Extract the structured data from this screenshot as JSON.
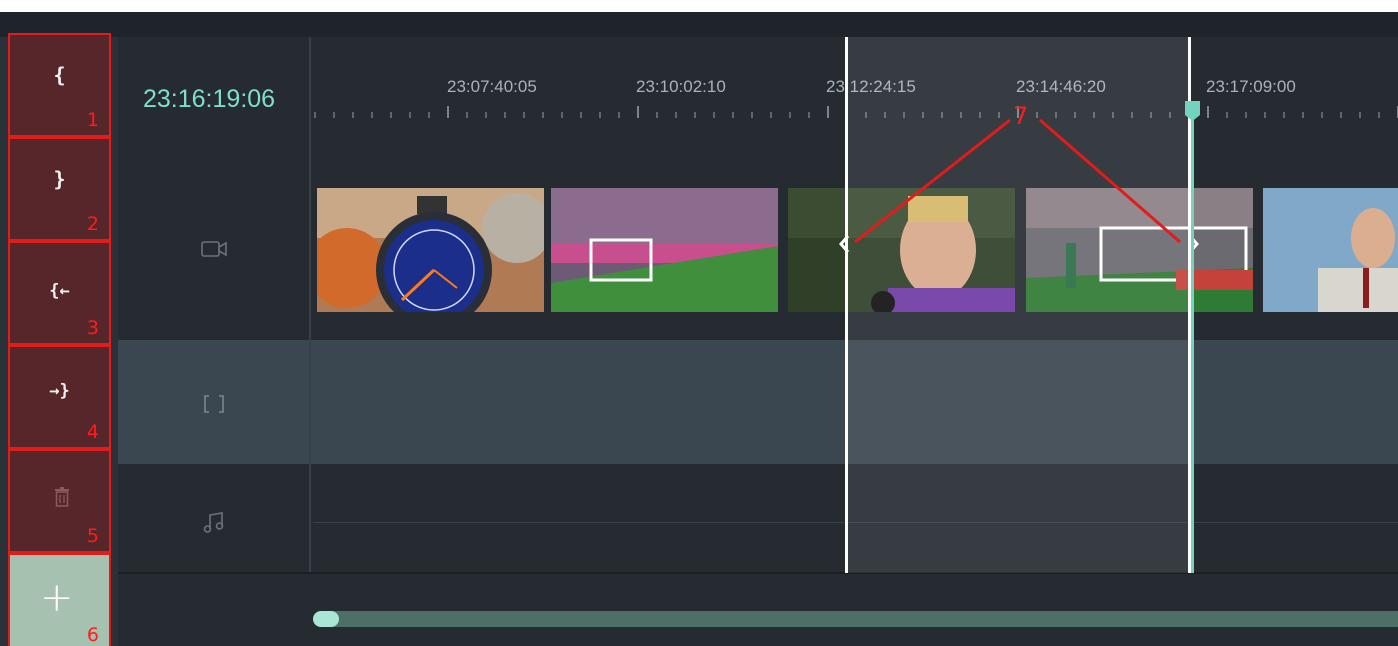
{
  "timeline": {
    "current_time": "23:16:19:06",
    "ruler_labels": [
      "23:07:40:05",
      "23:10:02:10",
      "23:12:24:15",
      "23:14:46:20",
      "23:17:09:00"
    ]
  },
  "toolbar": {
    "buttons": [
      {
        "id": "set-in",
        "glyph": "{",
        "annotation": "1"
      },
      {
        "id": "set-out",
        "glyph": "}",
        "annotation": "2"
      },
      {
        "id": "go-in",
        "glyph": "{←",
        "annotation": "3"
      },
      {
        "id": "go-out",
        "glyph": "→}",
        "annotation": "4"
      },
      {
        "id": "delete",
        "glyph": "trash-icon",
        "annotation": "5"
      },
      {
        "id": "add",
        "glyph": "+",
        "annotation": "6"
      }
    ]
  },
  "selection": {
    "annotation": "7"
  },
  "tracks": {
    "video_icon": "video-camera-icon",
    "overlay_icon": "brackets-icon",
    "audio_icon": "music-note-icon"
  },
  "colors": {
    "accent": "#7fe0c8",
    "annotation": "#e21b1b",
    "panel": "#262b32",
    "overlay_track": "#3a4650",
    "button_bg": "#56262b",
    "add_button_bg": "#a7c1b1"
  }
}
